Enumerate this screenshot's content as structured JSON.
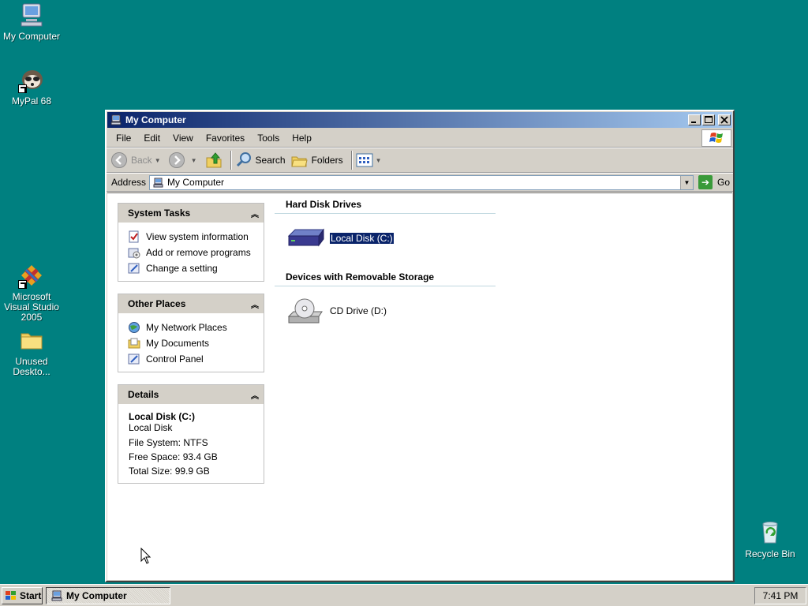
{
  "desktop": {
    "icons": [
      {
        "label": "My Computer"
      },
      {
        "label": "MyPal 68"
      },
      {
        "label": "Microsoft Visual Studio 2005"
      },
      {
        "label": "Unused Deskto..."
      },
      {
        "label": "Recycle Bin"
      }
    ]
  },
  "window": {
    "title": "My Computer",
    "menu": [
      "File",
      "Edit",
      "View",
      "Favorites",
      "Tools",
      "Help"
    ],
    "toolbar": {
      "back": "Back",
      "search": "Search",
      "folders": "Folders"
    },
    "address": {
      "label": "Address",
      "value": "My Computer",
      "go": "Go"
    }
  },
  "taskpane": {
    "system_tasks": {
      "title": "System Tasks",
      "items": [
        "View system information",
        "Add or remove programs",
        "Change a setting"
      ]
    },
    "other_places": {
      "title": "Other Places",
      "items": [
        "My Network Places",
        "My Documents",
        "Control Panel"
      ]
    },
    "details": {
      "title": "Details",
      "name": "Local Disk (C:)",
      "type": "Local Disk",
      "file_system": "File System: NTFS",
      "free_space": "Free Space: 93.4 GB",
      "total_size": "Total Size: 99.9 GB"
    }
  },
  "files": {
    "hard_disks": {
      "title": "Hard Disk Drives",
      "items": [
        {
          "label": "Local Disk (C:)",
          "selected": true
        }
      ]
    },
    "removable": {
      "title": "Devices with Removable Storage",
      "items": [
        {
          "label": "CD Drive (D:)",
          "selected": false
        }
      ]
    }
  },
  "taskbar": {
    "start": "Start",
    "task": "My Computer",
    "clock": "7:41 PM"
  },
  "colors": {
    "desktop": "#008080",
    "title_start": "#0a246a",
    "title_end": "#a6caf0",
    "selection": "#0a246a"
  }
}
